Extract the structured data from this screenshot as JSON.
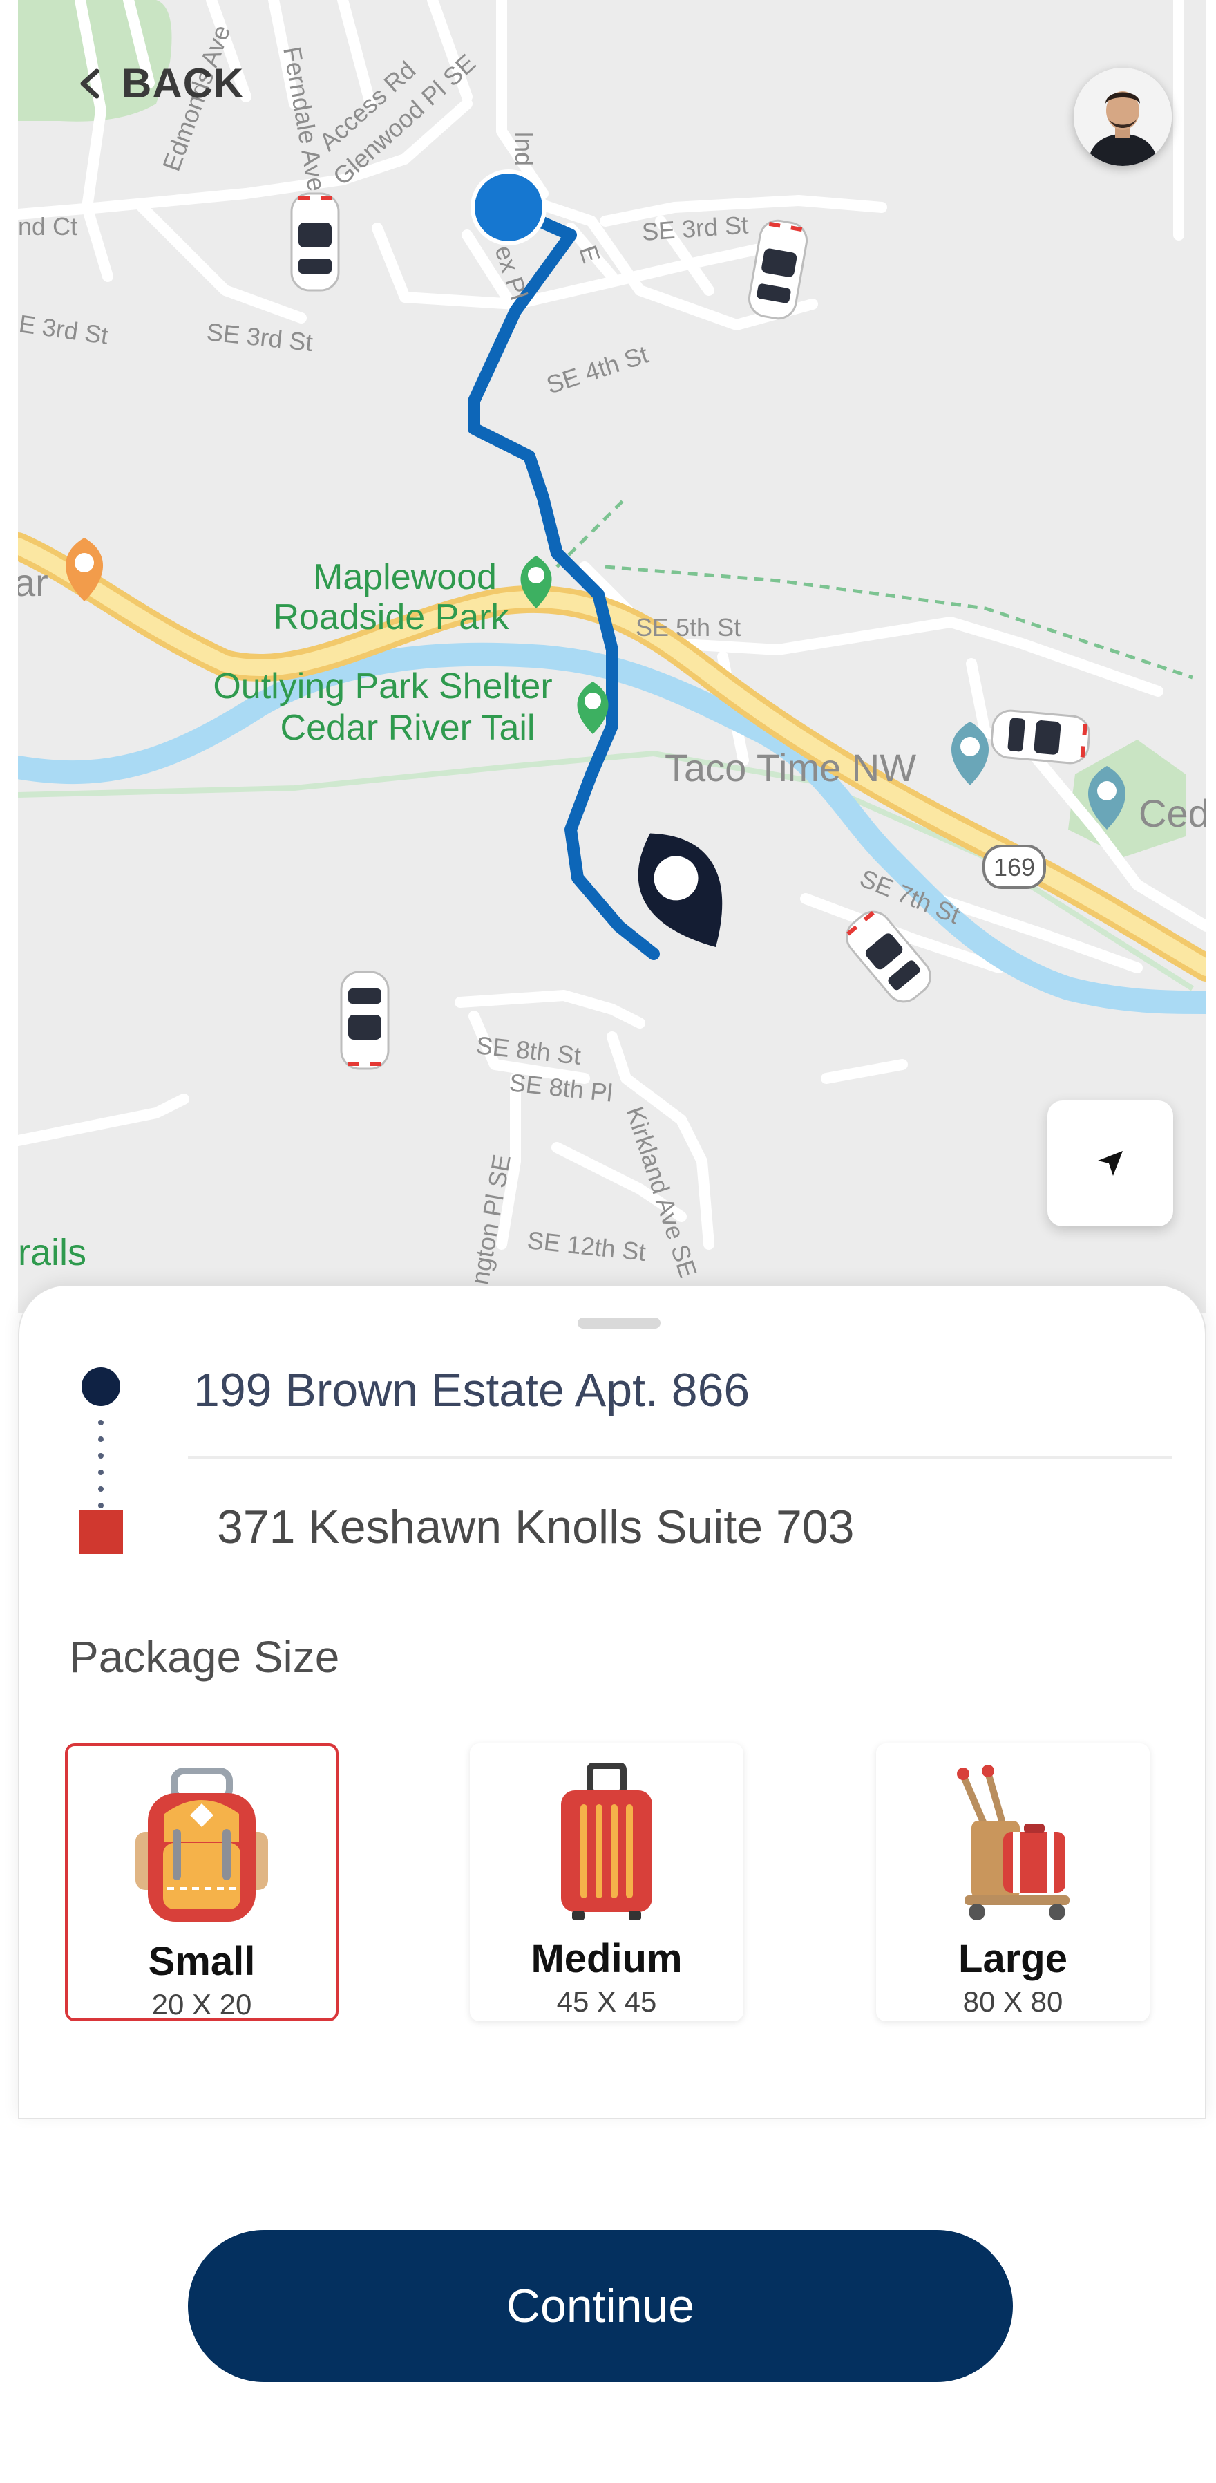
{
  "map": {
    "streets": [
      "Ferndale Ave",
      "Access Rd",
      "Glenwood Pl SE",
      "Edmonds Ave",
      "nd Ct",
      "E 3rd St",
      "SE 3rd St",
      "SE 3rd St",
      "SE 4th St",
      "SE 5th St",
      "SE 7th St",
      "SE 8th St",
      "SE 8th Pl",
      "SE 12th St",
      "Kirkland Ave SE",
      "ngton Pl SE",
      "Ind",
      "ex Pl",
      "E"
    ],
    "parks": [
      "Maplewood",
      "Roadside Park",
      "Outlying Park Shelter",
      "Cedar River Tail"
    ],
    "pois": [
      "Taco Time NW",
      "Ced"
    ],
    "route_badge": "169",
    "fragments": [
      "ar",
      "rails"
    ]
  },
  "header": {
    "back_label": "BACK"
  },
  "trip": {
    "origin": "199 Brown Estate Apt. 866",
    "destination": "371 Keshawn Knolls Suite 703"
  },
  "packages": {
    "title": "Package Size",
    "items": [
      {
        "name": "Small",
        "dims": "20 X 20",
        "selected": true
      },
      {
        "name": "Medium",
        "dims": "45 X 45",
        "selected": false
      },
      {
        "name": "Large",
        "dims": "80 X 80",
        "selected": false
      }
    ]
  },
  "colors": {
    "primary": "#04305f",
    "accent": "#d9363a",
    "route": "#0d66b8",
    "origin": "#0f2244"
  },
  "actions": {
    "continue_label": "Continue"
  }
}
